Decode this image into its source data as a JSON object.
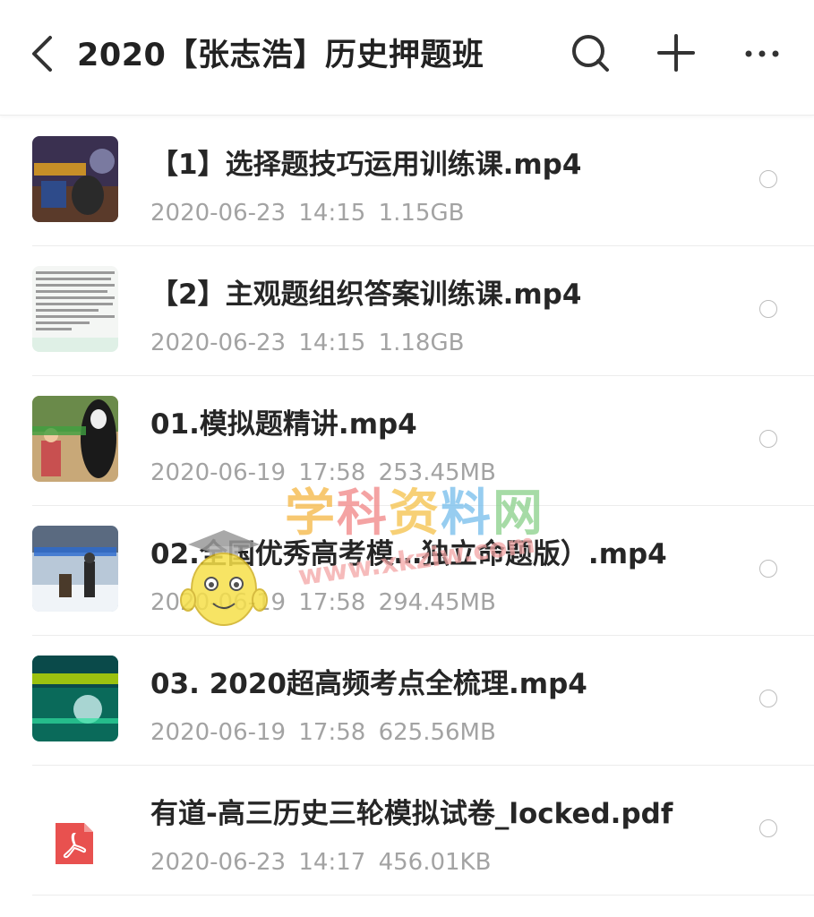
{
  "header": {
    "title": "2020【张志浩】历史押题班",
    "back_icon": "chevron-left-icon",
    "search_icon": "search-icon",
    "add_icon": "plus-icon",
    "more_icon": "more-horizontal-icon"
  },
  "files": [
    {
      "name": "【1】选择题技巧运用训练课.mp4",
      "date": "2020-06-23",
      "time": "14:15",
      "size": "1.15GB",
      "type": "video"
    },
    {
      "name": "【2】主观题组织答案训练课.mp4",
      "date": "2020-06-23",
      "time": "14:15",
      "size": "1.18GB",
      "type": "video"
    },
    {
      "name": "01.模拟题精讲.mp4",
      "date": "2020-06-19",
      "time": "17:58",
      "size": "253.45MB",
      "type": "video"
    },
    {
      "name": "02.全国优秀高考模…独立命题版）.mp4",
      "date": "2020-06-19",
      "time": "17:58",
      "size": "294.45MB",
      "type": "video"
    },
    {
      "name": "03. 2020超高频考点全梳理.mp4",
      "date": "2020-06-19",
      "time": "17:58",
      "size": "625.56MB",
      "type": "video"
    },
    {
      "name": "有道-高三历史三轮模拟试卷_locked.pdf",
      "date": "2020-06-23",
      "time": "14:17",
      "size": "456.01KB",
      "type": "pdf"
    }
  ],
  "watermark": {
    "text": "学科资料网",
    "url": "www.xkziw.com"
  },
  "colors": {
    "title": "#222222",
    "meta": "#a3a3a3",
    "pdf_red": "#e8514f",
    "divider": "#ececec"
  }
}
